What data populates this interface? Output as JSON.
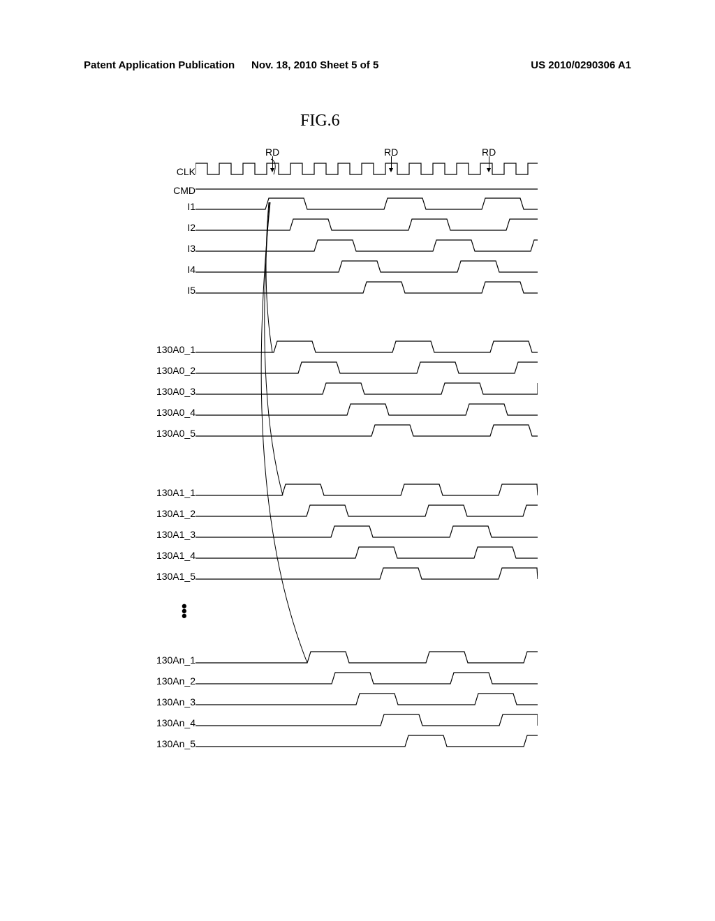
{
  "header": {
    "left": "Patent Application Publication",
    "center": "Nov. 18, 2010  Sheet 5 of 5",
    "right": "US 2010/0290306 A1"
  },
  "figure_title": "FIG.6",
  "rd_labels": [
    "RD",
    "RD",
    "RD"
  ],
  "rows": {
    "clk": "CLK",
    "cmd": "CMD",
    "i1": "I1",
    "i2": "I2",
    "i3": "I3",
    "i4": "I4",
    "i5": "I5",
    "a0_1": "130A0_1",
    "a0_2": "130A0_2",
    "a0_3": "130A0_3",
    "a0_4": "130A0_4",
    "a0_5": "130A0_5",
    "a1_1": "130A1_1",
    "a1_2": "130A1_2",
    "a1_3": "130A1_3",
    "a1_4": "130A1_4",
    "a1_5": "130A1_5",
    "an_1": "130An_1",
    "an_2": "130An_2",
    "an_3": "130An_3",
    "an_4": "130An_4",
    "an_5": "130An_5"
  }
}
